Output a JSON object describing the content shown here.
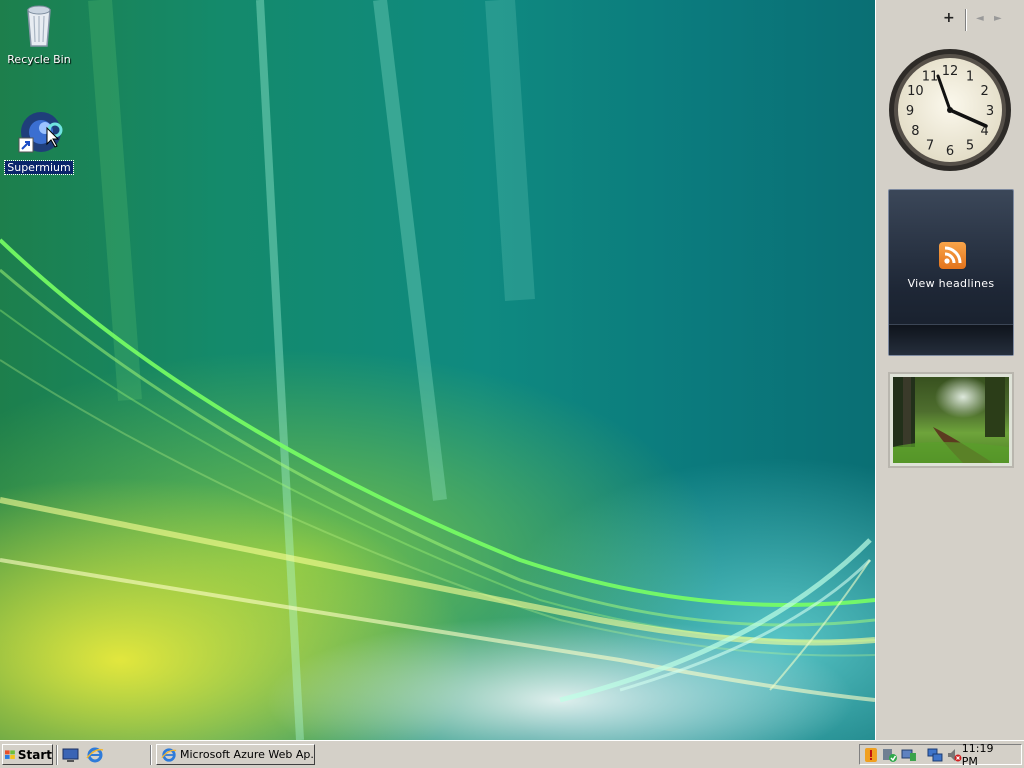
{
  "desktop": {
    "icons": [
      {
        "label": "Recycle Bin"
      },
      {
        "label": "Supermium"
      }
    ]
  },
  "sidebar": {
    "add_label": "+",
    "prev_label": "◄",
    "next_label": "►",
    "clock": {
      "numbers": [
        "12",
        "1",
        "2",
        "3",
        "4",
        "5",
        "6",
        "7",
        "8",
        "9",
        "10",
        "11"
      ]
    },
    "feed": {
      "label": "View headlines"
    }
  },
  "taskbar": {
    "start_label": "Start",
    "window_button": "Microsoft Azure Web Ap...",
    "time": "11:19 PM"
  },
  "colors": {
    "taskbar_bg": "#d4d0c8",
    "selection": "#0a246a",
    "rss_orange": "#f08a24"
  }
}
